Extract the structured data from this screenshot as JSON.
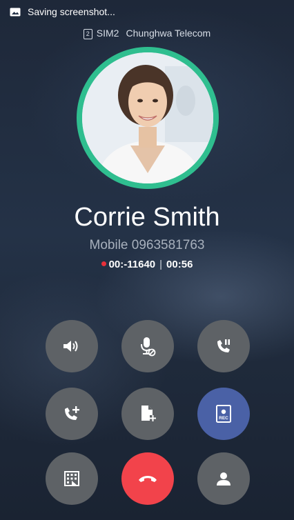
{
  "status_bar": {
    "notification_text": "Saving screenshot...",
    "sim_badge": "2",
    "sim_label": "SIM2",
    "carrier": "Chunghwa Telecom"
  },
  "caller": {
    "name": "Corrie Smith",
    "number": "Mobile 0963581763",
    "record_time": "00:-11640",
    "separator": "|",
    "call_duration": "00:56"
  },
  "controls": {
    "speaker": "speaker-icon",
    "mute": "mic-off-icon",
    "hold": "phone-hold-icon",
    "add_call": "add-call-icon",
    "note": "note-add-icon",
    "record": "record-icon",
    "record_label": "REC",
    "dialpad": "dialpad-icon",
    "end_call": "end-call-icon",
    "contacts": "contact-icon"
  },
  "colors": {
    "avatar_ring": "#2fbe8f",
    "record_button": "#4a61a6",
    "end_call_button": "#f2434b",
    "control_button": "#5e6266",
    "recording_dot": "#e8303a"
  }
}
